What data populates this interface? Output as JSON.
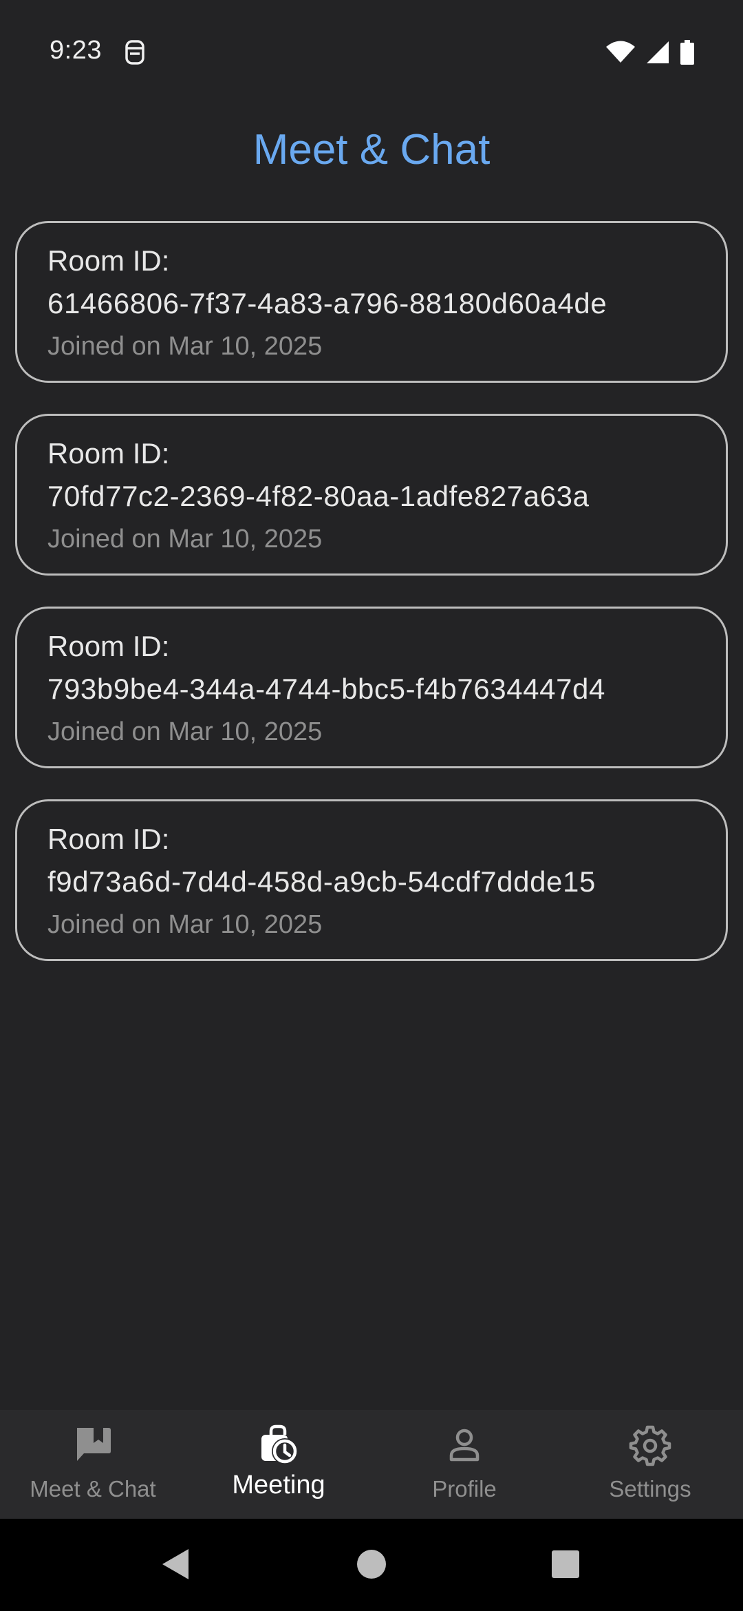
{
  "status_bar": {
    "time": "9:23",
    "icons": [
      "notification-icon",
      "wifi-icon",
      "signal-icon",
      "battery-icon"
    ]
  },
  "header": {
    "title": "Meet & Chat"
  },
  "rooms": [
    {
      "label": "Room ID:",
      "id": "61466806-7f37-4a83-a796-88180d60a4de",
      "joined": "Joined on Mar 10, 2025"
    },
    {
      "label": "Room ID:",
      "id": "70fd77c2-2369-4f82-80aa-1adfe827a63a",
      "joined": "Joined on Mar 10, 2025"
    },
    {
      "label": "Room ID:",
      "id": "793b9be4-344a-4744-bbc5-f4b7634447d4",
      "joined": "Joined on Mar 10, 2025"
    },
    {
      "label": "Room ID:",
      "id": "f9d73a6d-7d4d-458d-a9cb-54cdf7ddde15",
      "joined": "Joined on Mar 10, 2025"
    }
  ],
  "bottom_nav": {
    "items": [
      {
        "label": "Meet & Chat",
        "icon": "chat-bookmark-icon",
        "active": false
      },
      {
        "label": "Meeting",
        "icon": "meeting-clock-icon",
        "active": true
      },
      {
        "label": "Profile",
        "icon": "person-icon",
        "active": false
      },
      {
        "label": "Settings",
        "icon": "gear-icon",
        "active": false
      }
    ]
  },
  "system_nav": {
    "buttons": [
      "back-icon",
      "home-icon",
      "recents-icon"
    ]
  },
  "colors": {
    "background": "#232325",
    "accent": "#6aa9f0",
    "card_border": "#bdbdbd",
    "muted_text": "#8f8f8f",
    "nav_background": "#2a2a2c"
  }
}
